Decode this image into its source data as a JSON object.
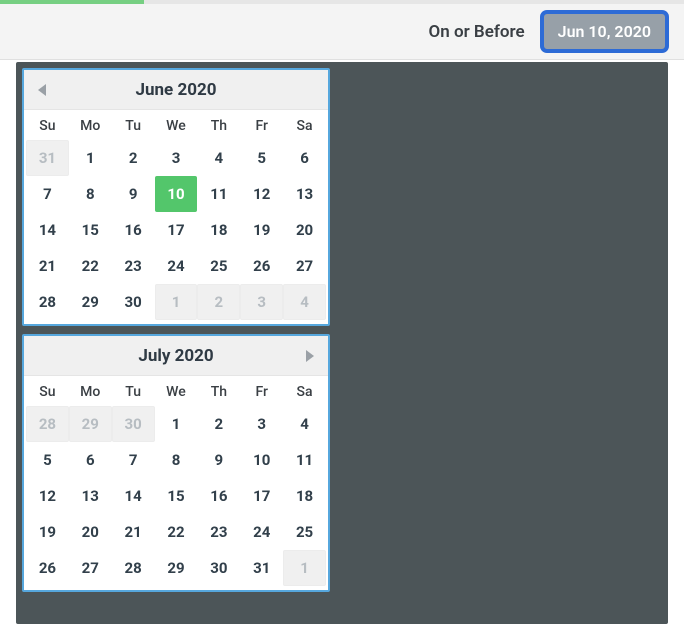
{
  "header": {
    "label": "On or Before",
    "date_chip": "Jun 10, 2020"
  },
  "dow": [
    "Su",
    "Mo",
    "Tu",
    "We",
    "Th",
    "Fr",
    "Sa"
  ],
  "calendars": [
    {
      "title": "June 2020",
      "show_prev": true,
      "show_next": false,
      "days": [
        {
          "n": 31,
          "other": true
        },
        {
          "n": 1
        },
        {
          "n": 2
        },
        {
          "n": 3
        },
        {
          "n": 4
        },
        {
          "n": 5
        },
        {
          "n": 6
        },
        {
          "n": 7
        },
        {
          "n": 8
        },
        {
          "n": 9
        },
        {
          "n": 10,
          "sel": true
        },
        {
          "n": 11
        },
        {
          "n": 12
        },
        {
          "n": 13
        },
        {
          "n": 14
        },
        {
          "n": 15
        },
        {
          "n": 16
        },
        {
          "n": 17
        },
        {
          "n": 18
        },
        {
          "n": 19
        },
        {
          "n": 20
        },
        {
          "n": 21
        },
        {
          "n": 22
        },
        {
          "n": 23
        },
        {
          "n": 24
        },
        {
          "n": 25
        },
        {
          "n": 26
        },
        {
          "n": 27
        },
        {
          "n": 28
        },
        {
          "n": 29
        },
        {
          "n": 30
        },
        {
          "n": 1,
          "other": true
        },
        {
          "n": 2,
          "other": true
        },
        {
          "n": 3,
          "other": true
        },
        {
          "n": 4,
          "other": true
        }
      ]
    },
    {
      "title": "July 2020",
      "show_prev": false,
      "show_next": true,
      "days": [
        {
          "n": 28,
          "other": true
        },
        {
          "n": 29,
          "other": true
        },
        {
          "n": 30,
          "other": true
        },
        {
          "n": 1
        },
        {
          "n": 2
        },
        {
          "n": 3
        },
        {
          "n": 4
        },
        {
          "n": 5
        },
        {
          "n": 6
        },
        {
          "n": 7
        },
        {
          "n": 8
        },
        {
          "n": 9
        },
        {
          "n": 10
        },
        {
          "n": 11
        },
        {
          "n": 12
        },
        {
          "n": 13
        },
        {
          "n": 14
        },
        {
          "n": 15
        },
        {
          "n": 16
        },
        {
          "n": 17
        },
        {
          "n": 18
        },
        {
          "n": 19
        },
        {
          "n": 20
        },
        {
          "n": 21
        },
        {
          "n": 22
        },
        {
          "n": 23
        },
        {
          "n": 24
        },
        {
          "n": 25
        },
        {
          "n": 26
        },
        {
          "n": 27
        },
        {
          "n": 28
        },
        {
          "n": 29
        },
        {
          "n": 30
        },
        {
          "n": 31
        },
        {
          "n": 1,
          "other": true
        }
      ]
    }
  ]
}
